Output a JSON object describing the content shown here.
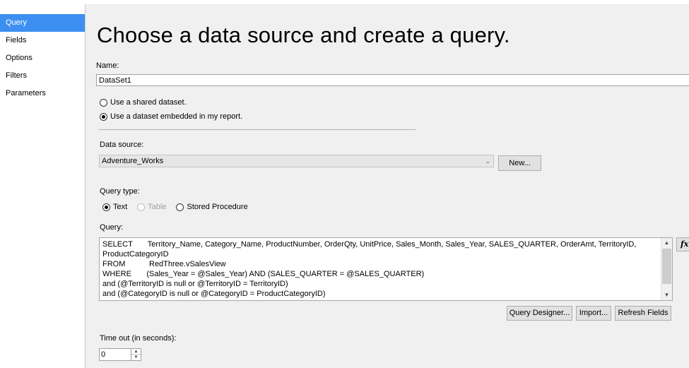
{
  "sidebar": {
    "items": [
      {
        "label": "Query",
        "selected": true
      },
      {
        "label": "Fields",
        "selected": false
      },
      {
        "label": "Options",
        "selected": false
      },
      {
        "label": "Filters",
        "selected": false
      },
      {
        "label": "Parameters",
        "selected": false
      }
    ]
  },
  "main": {
    "title": "Choose a data source and create a query.",
    "name_label": "Name:",
    "name_value": "DataSet1",
    "dataset_options": {
      "shared_label": "Use a shared dataset.",
      "embedded_label": "Use a dataset embedded in my report.",
      "selected": "embedded"
    },
    "data_source_label": "Data source:",
    "data_source_value": "Adventure_Works",
    "new_button": "New...",
    "query_type_label": "Query type:",
    "query_types": {
      "text": "Text",
      "table": "Table",
      "stored_procedure": "Stored Procedure",
      "selected": "text"
    },
    "query_label": "Query:",
    "query_text": "SELECT       Territory_Name, Category_Name, ProductNumber, OrderQty, UnitPrice, Sales_Month, Sales_Year, SALES_QUARTER, OrderAmt, TerritoryID,\nProductCategoryID\nFROM           RedThree.vSalesView\nWHERE       (Sales_Year = @Sales_Year) AND (SALES_QUARTER = @SALES_QUARTER)\nand (@TerritoryID is null or @TerritoryID = TerritoryID)\nand (@CategoryID is null or @CategoryID = ProductCategoryID)",
    "fx_button": "fx",
    "query_designer_button": "Query Designer...",
    "import_button": "Import...",
    "refresh_fields_button": "Refresh Fields",
    "timeout_label": "Time out (in seconds):",
    "timeout_value": "0"
  },
  "icons": {
    "dropdown": "chevron-down-icon",
    "scroll_up": "scroll-up-arrow-icon",
    "scroll_down": "scroll-down-arrow-icon",
    "spin_up": "spin-up-icon",
    "spin_down": "spin-down-icon"
  },
  "colors": {
    "selected_nav": "#3c8ff0",
    "panel_background": "#f0f0f0"
  }
}
